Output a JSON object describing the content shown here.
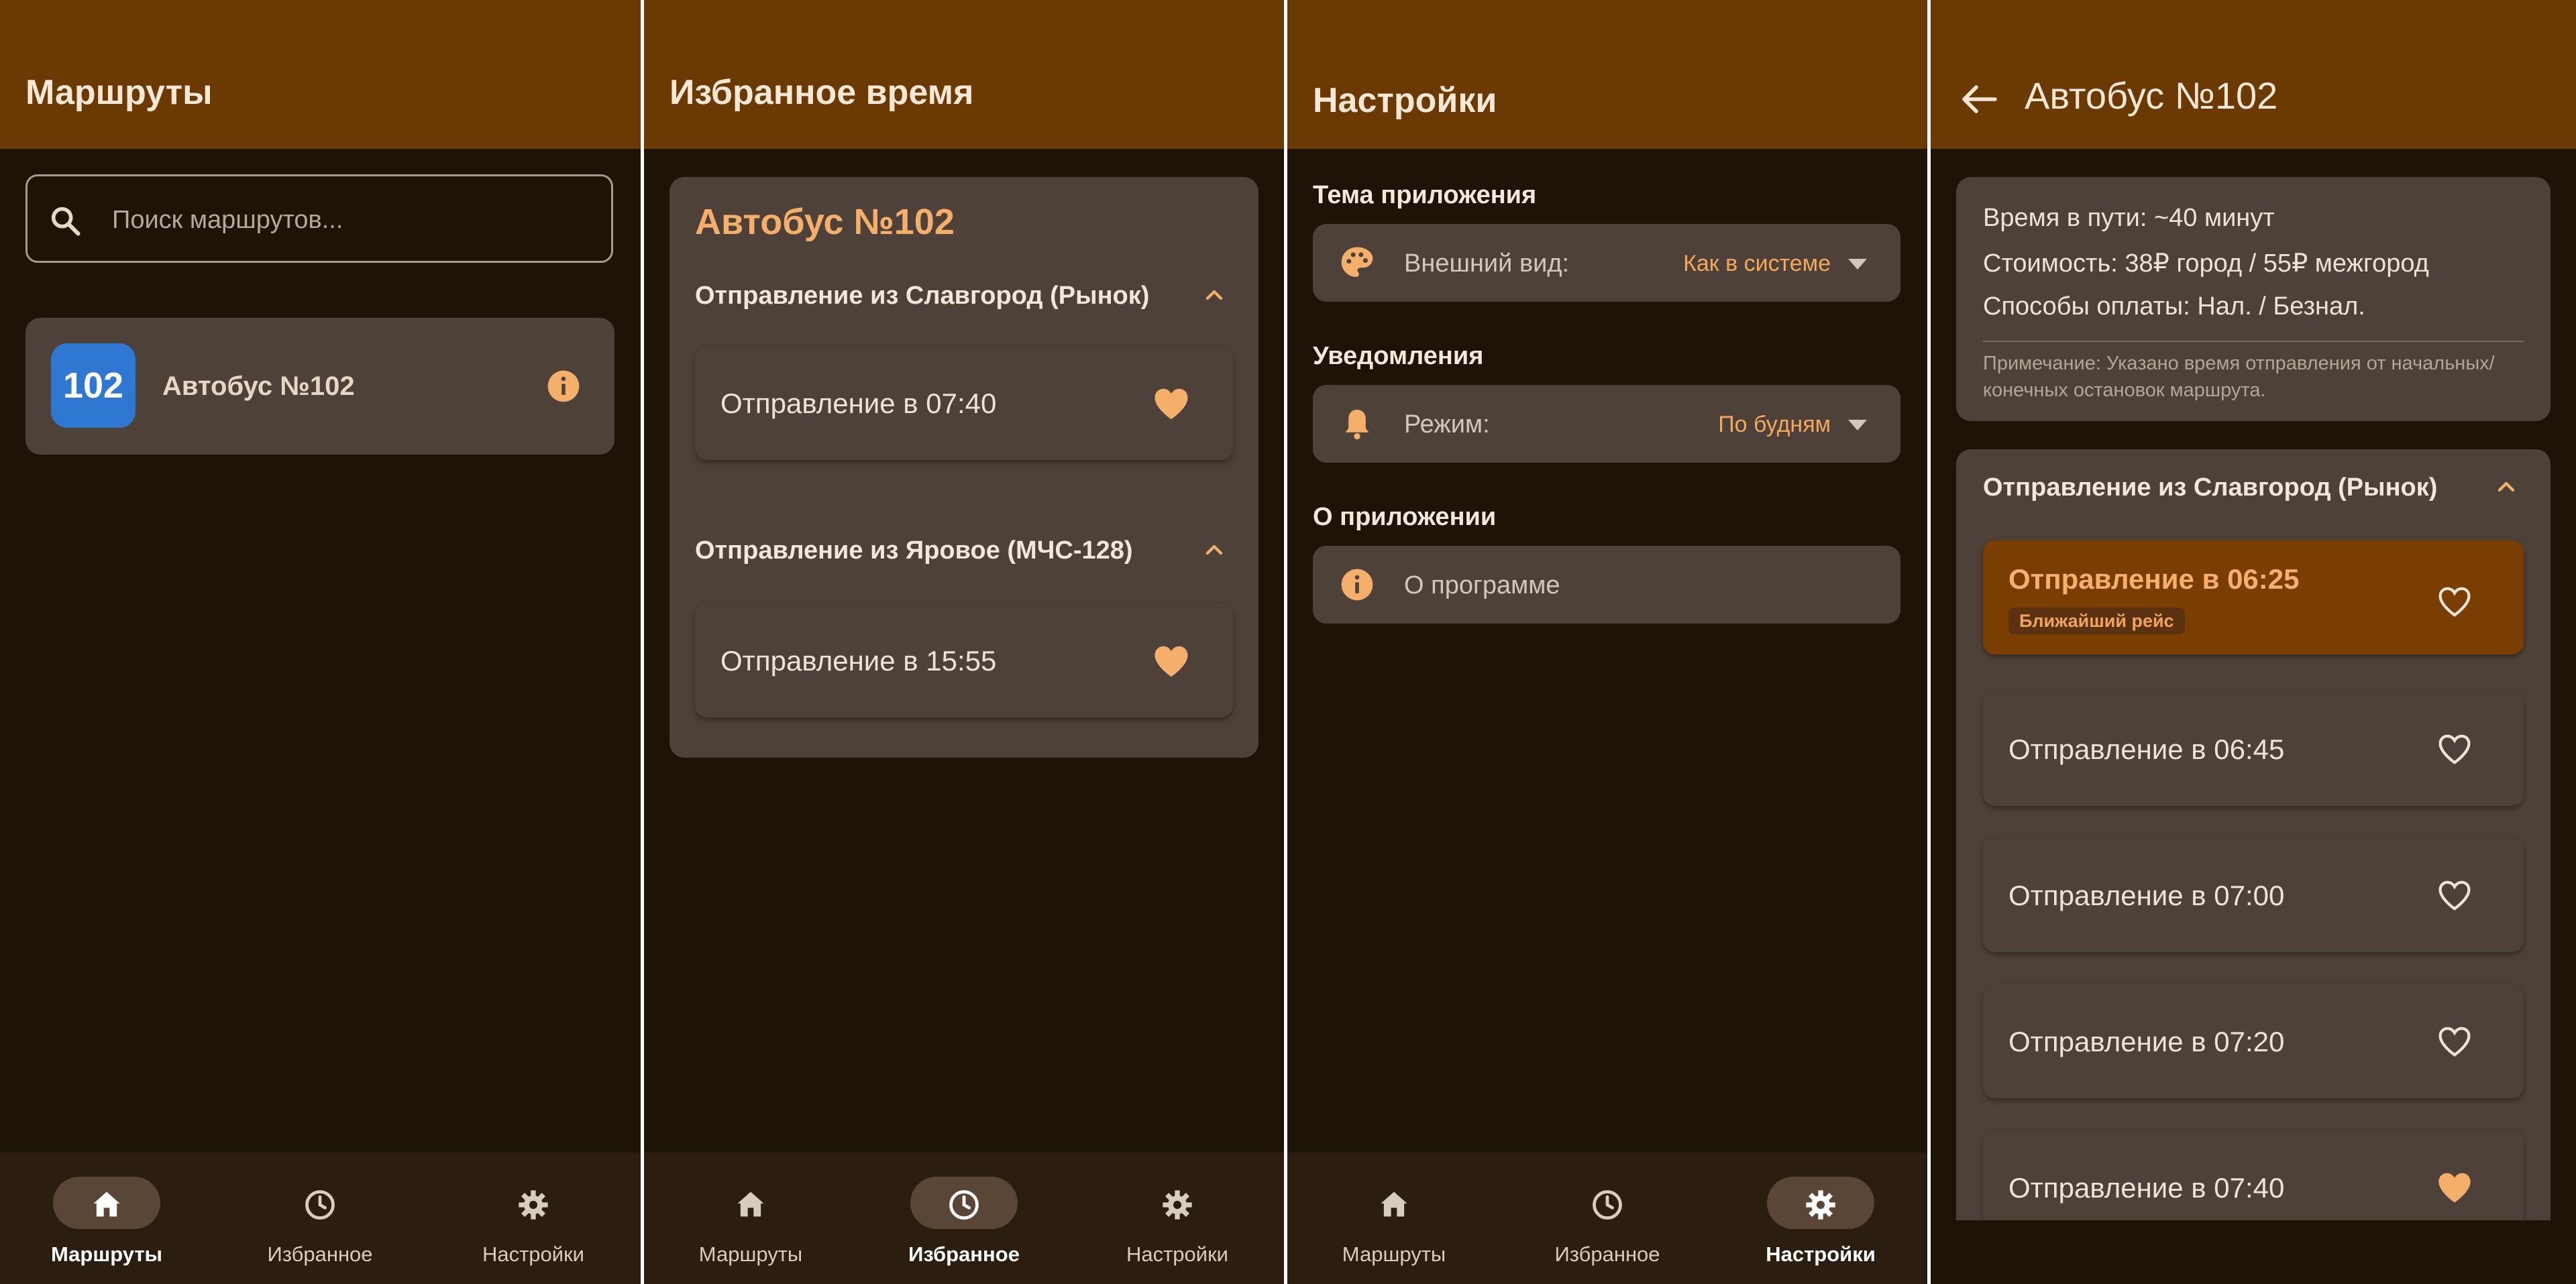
{
  "colors": {
    "appbar": "#6b3a03",
    "background": "#1d1307",
    "card": "#4e4139",
    "accent": "#f4b06a",
    "badge_blue": "#2f78d2",
    "nav_bar": "#2b1d10"
  },
  "nav": {
    "routes": "Маршруты",
    "favorites": "Избранное",
    "settings": "Настройки"
  },
  "screen_routes": {
    "title": "Маршруты",
    "search_placeholder": "Поиск маршрутов...",
    "route": {
      "number": "102",
      "name": "Автобус №102",
      "icon": "info-icon"
    }
  },
  "screen_favorites": {
    "title": "Избранное время",
    "card_title": "Автобус №102",
    "sections": [
      {
        "header": "Отправление из Славгород (Рынок)",
        "times": [
          "Отправление в 07:40"
        ]
      },
      {
        "header": "Отправление из Яровое (МЧС-128)",
        "times": [
          "Отправление в 15:55"
        ]
      }
    ]
  },
  "screen_settings": {
    "title": "Настройки",
    "theme": {
      "header": "Тема приложения",
      "label": "Внешний вид:",
      "value": "Как в системе",
      "icon": "palette-icon"
    },
    "notifications": {
      "header": "Уведомления",
      "label": "Режим:",
      "value": "По будням",
      "icon": "bell-icon"
    },
    "about": {
      "header": "О приложении",
      "label": "О программе",
      "icon": "info-icon"
    }
  },
  "screen_detail": {
    "title": "Автобус №102",
    "travel_time": "Время в пути: ~40 минут",
    "cost": "Стоимость: 38₽ город / 55₽ межгород",
    "payment": "Способы оплаты: Нал. / Безнал.",
    "note": "Примечание: Указано время отправления от начальных/конечных остановок маршрута.",
    "section_header": "Отправление из Славгород (Рынок)",
    "departures": [
      {
        "time": "Отправление в 06:25",
        "badge": "Ближайший рейс",
        "favorite": false
      },
      {
        "time": "Отправление в 06:45",
        "favorite": false
      },
      {
        "time": "Отправление в 07:00",
        "favorite": false
      },
      {
        "time": "Отправление в 07:20",
        "favorite": false
      },
      {
        "time": "Отправление в 07:40",
        "favorite": true
      }
    ]
  }
}
